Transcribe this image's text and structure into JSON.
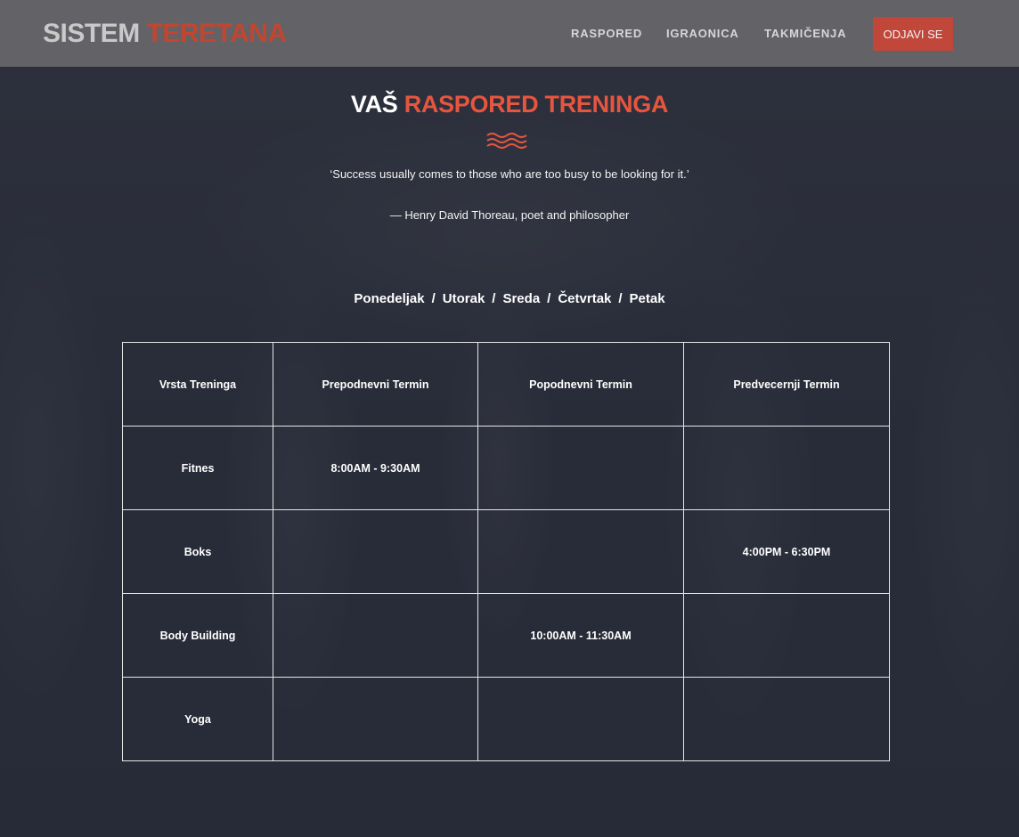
{
  "navbar": {
    "brand_white": "SISTEM",
    "brand_red": "TERETANA",
    "links": [
      "RASPORED",
      "IGRAONICA",
      "TAKMIČENJA"
    ],
    "logout_label": "ODJAVI SE"
  },
  "header": {
    "title_white": "VAŠ",
    "title_red": "RASPORED TRENINGA",
    "quote": "‘Success usually comes to those who are too busy to be looking for it.’",
    "author": "— Henry David Thoreau, poet and philosopher"
  },
  "days": [
    "Ponedeljak",
    "Utorak",
    "Sreda",
    "Četvrtak",
    "Petak"
  ],
  "days_separator": "/",
  "table": {
    "headers": [
      "Vrsta Treninga",
      "Prepodnevni Termin",
      "Popodnevni Termin",
      "Predvecernji Termin"
    ],
    "rows": [
      [
        "Fitnes",
        "8:00AM - 9:30AM",
        "",
        ""
      ],
      [
        "Boks",
        "",
        "",
        "4:00PM - 6:30PM"
      ],
      [
        "Body Building",
        "",
        "10:00AM - 11:30AM",
        ""
      ],
      [
        "Yoga",
        "",
        "",
        ""
      ]
    ]
  },
  "colors": {
    "accent": "#e8553e",
    "button": "#c0473a",
    "navbar": "#6e6e70"
  }
}
